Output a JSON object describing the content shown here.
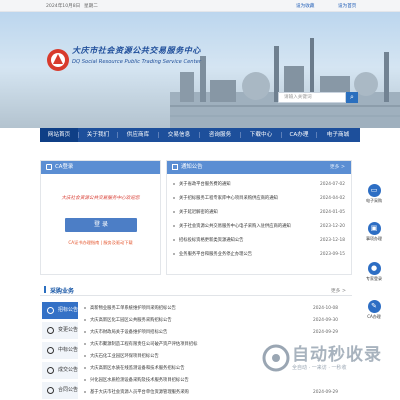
{
  "topbar": {
    "date": "2024年10月8日",
    "weekday": "星期二",
    "favorite": "设为收藏",
    "home": "设为首页"
  },
  "header": {
    "org_name_cn": "大庆市社会资源公共交易服务中心",
    "org_name_en": "DQ Social Resource Public Trading Service Center",
    "search_placeholder": "请输入关键词"
  },
  "nav": {
    "items": [
      "网站首页",
      "关于我们",
      "供应商库",
      "交易信息",
      "咨询服务",
      "下载中心",
      "CA办理",
      "电子商城"
    ]
  },
  "login": {
    "title": "CA登录",
    "prompt": "大庆社会资源公共交易服务中心欢迎您",
    "button": "登 录",
    "links": "CA证书办理指南 | 服务及驱动下载"
  },
  "notices": {
    "title": "通知公告",
    "more": "更多 >",
    "items": [
      {
        "title": "关于省政平台服务费的通知",
        "date": "2024-07-02"
      },
      {
        "title": "关于招标服务工程专家库中心项目采购供应商的通知",
        "date": "2024-04-02"
      },
      {
        "title": "关于延迟解密的通知",
        "date": "2024-01-05"
      },
      {
        "title": "关于社会资源公共交易服务中心电子采购入驻供应商的通知",
        "date": "2023-12-20"
      },
      {
        "title": "招标投标资格更新类资源通知公告",
        "date": "2023-12-18"
      },
      {
        "title": "业务服务平台和服务业务停止办理公告",
        "date": "2023-09-15"
      }
    ]
  },
  "sidebar": [
    {
      "label": "电子采购",
      "icon": "computer-icon"
    },
    {
      "label": "事项办理",
      "icon": "briefcase-icon"
    },
    {
      "label": "专家登录",
      "icon": "user-icon"
    },
    {
      "label": "CA办理",
      "icon": "certificate-icon"
    }
  ],
  "purchase": {
    "title": "采购业务",
    "more": "更多 >",
    "tabs": [
      "招标公告",
      "变更公告",
      "中标公告",
      "成交公告",
      "合同公告"
    ],
    "items": [
      {
        "title": "高新物业服务工单系统维护项目采购招标公告",
        "date": "2024-10-08"
      },
      {
        "title": "大庆高新区化工园区公共服务采购招标公告",
        "date": "2024-09-30"
      },
      {
        "title": "大庆市财政局关于设备维护项目招标公告",
        "date": "2024-09-29"
      },
      {
        "title": "大庆市聚源制造工程有限责任公司破产资产评估项目招标",
        "date": ""
      },
      {
        "title": "大庆石化工业园区环保项目招标公告",
        "date": ""
      },
      {
        "title": "大庆高新区水质在线监测设备和技术服务招标公告",
        "date": ""
      },
      {
        "title": "兴化园区水质检测设备采购及技术服务项目招标公告",
        "date": ""
      },
      {
        "title": "基于大庆市社会资源人员平台单位资源管理服务采购",
        "date": "2024-09-29"
      }
    ]
  },
  "watermark": {
    "text": "自动秒收录",
    "sub": "全自动 · 一来访 · 一秒收"
  },
  "colors": {
    "primary": "#1d4f9b",
    "accent": "#5b8ed3",
    "alert": "#d7392f"
  }
}
